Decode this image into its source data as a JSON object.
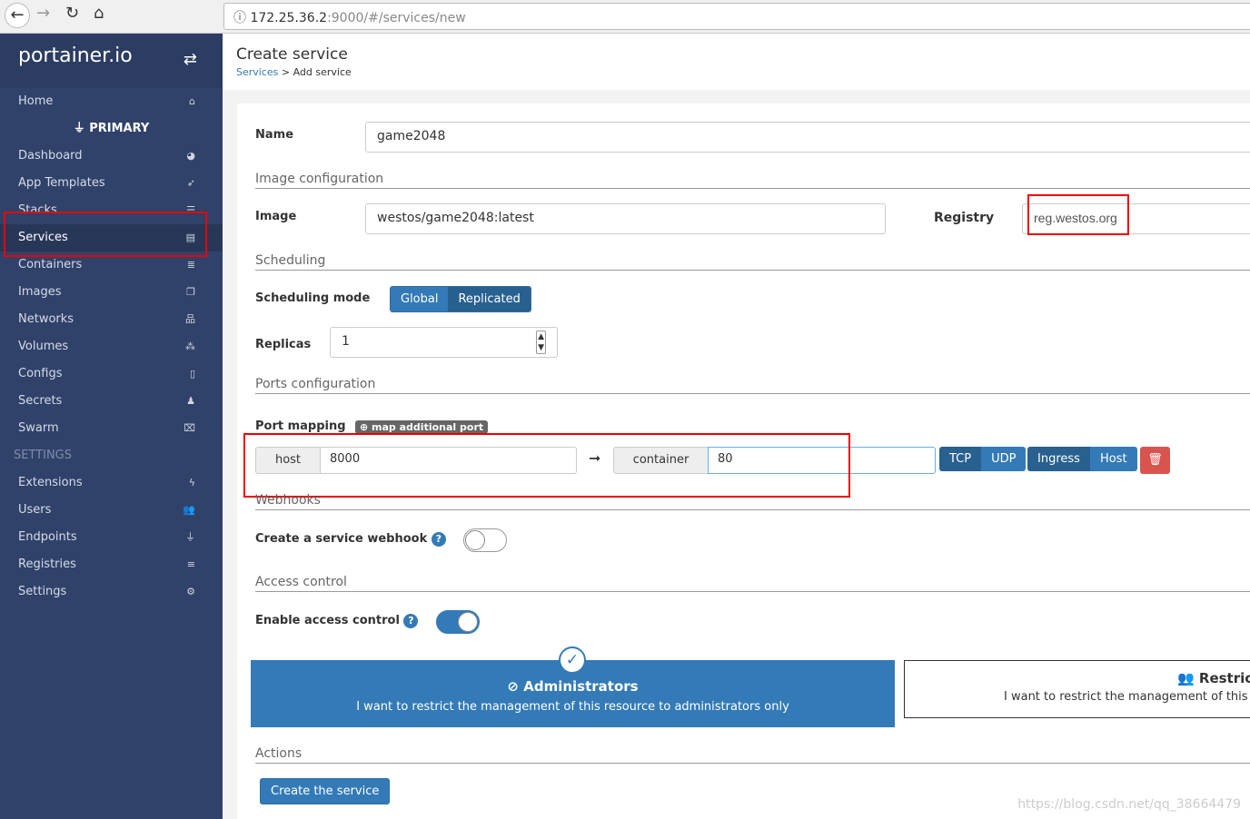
{
  "browser": {
    "url_host": "172.25.36.2",
    "url_rest": ":9000/#/services/new"
  },
  "sidebar": {
    "logo": "portainer.io",
    "items": [
      {
        "label": "Home",
        "icon": "home-icon",
        "glyph": "⌂"
      },
      {
        "label": "PRIMARY",
        "icon": "plug-icon",
        "glyph": "",
        "type": "primary"
      },
      {
        "label": "Dashboard",
        "icon": "dashboard-icon",
        "glyph": "◕"
      },
      {
        "label": "App Templates",
        "icon": "rocket-icon",
        "glyph": "➶"
      },
      {
        "label": "Stacks",
        "icon": "th-list-icon",
        "glyph": "☰"
      },
      {
        "label": "Services",
        "icon": "list-alt-icon",
        "glyph": "▤",
        "active": true
      },
      {
        "label": "Containers",
        "icon": "server-icon",
        "glyph": "≣"
      },
      {
        "label": "Images",
        "icon": "clone-icon",
        "glyph": "❐"
      },
      {
        "label": "Networks",
        "icon": "sitemap-icon",
        "glyph": "品"
      },
      {
        "label": "Volumes",
        "icon": "cubes-icon",
        "glyph": "⁂"
      },
      {
        "label": "Configs",
        "icon": "file-code-icon",
        "glyph": "▯"
      },
      {
        "label": "Secrets",
        "icon": "user-secret-icon",
        "glyph": "♟"
      },
      {
        "label": "Swarm",
        "icon": "object-group-icon",
        "glyph": "⌧"
      },
      {
        "label": "SETTINGS",
        "type": "section",
        "glyph": ""
      },
      {
        "label": "Extensions",
        "icon": "bolt-icon",
        "glyph": "ϟ"
      },
      {
        "label": "Users",
        "icon": "users-icon",
        "glyph": "👥"
      },
      {
        "label": "Endpoints",
        "icon": "plug-icon",
        "glyph": "⏚"
      },
      {
        "label": "Registries",
        "icon": "database-icon",
        "glyph": "≡"
      },
      {
        "label": "Settings",
        "icon": "cogs-icon",
        "glyph": "⚙"
      }
    ]
  },
  "header": {
    "title": "Create service",
    "crumb_link": "Services",
    "crumb_rest": " > Add service"
  },
  "form": {
    "name_label": "Name",
    "name_value": "game2048",
    "image_section": "Image configuration",
    "image_label": "Image",
    "image_value": "westos/game2048:latest",
    "registry_label": "Registry",
    "registry_value": "reg.westos.org",
    "scheduling_section": "Scheduling",
    "mode_label": "Scheduling mode",
    "mode_global": "Global",
    "mode_replicated": "Replicated",
    "replicas_label": "Replicas",
    "replicas_value": "1",
    "ports_section": "Ports configuration",
    "port_mapping_label": "Port mapping",
    "map_port_button": "map additional port",
    "host_addon": "host",
    "host_value": "8000",
    "container_addon": "container",
    "container_value": "80",
    "tcp": "TCP",
    "udp": "UDP",
    "ingress": "Ingress",
    "host_mode": "Host",
    "webhooks_section": "Webhooks",
    "webhook_label": "Create a service webhook",
    "webhook_enabled": false,
    "access_section": "Access control",
    "access_label": "Enable access control",
    "access_enabled": true,
    "admin_title": "Administrators",
    "admin_desc": "I want to restrict the management of this resource to administrators only",
    "restricted_title": "Restricted",
    "restricted_desc": "I want to restrict the management of this resource to a set of users and/or teams",
    "actions_section": "Actions",
    "create_button": "Create the service"
  },
  "watermark": "https://blog.csdn.net/qq_38664479",
  "colors": {
    "sidebar": "#30426a",
    "primary": "#337ab7",
    "active": "#286090",
    "danger": "#d9534f",
    "highlight": "#e00000"
  }
}
